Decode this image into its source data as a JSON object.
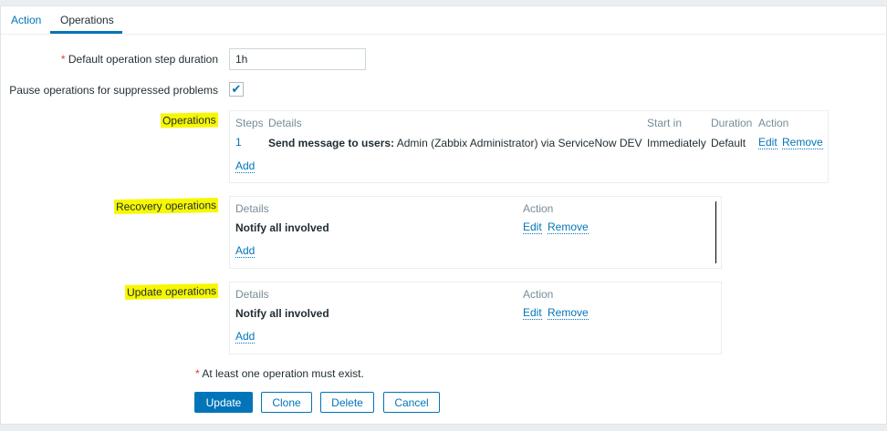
{
  "tabs": [
    {
      "label": "Action"
    },
    {
      "label": "Operations",
      "active": true
    }
  ],
  "form": {
    "step_duration_label": "Default operation step duration",
    "step_duration_value": "1h",
    "pause_label": "Pause operations for suppressed problems",
    "pause_checked": true,
    "required_mark": "*"
  },
  "operations": {
    "label": "Operations",
    "headers": {
      "steps": "Steps",
      "details": "Details",
      "start_in": "Start in",
      "duration": "Duration",
      "action": "Action"
    },
    "rows": [
      {
        "step": "1",
        "details_bold": "Send message to users:",
        "details_rest": " Admin (Zabbix Administrator) via ServiceNow DEV",
        "start_in": "Immediately",
        "duration": "Default",
        "edit": "Edit",
        "remove": "Remove"
      }
    ],
    "add": "Add"
  },
  "recovery": {
    "label": "Recovery operations",
    "headers": {
      "details": "Details",
      "action": "Action"
    },
    "rows": [
      {
        "details": "Notify all involved",
        "edit": "Edit",
        "remove": "Remove"
      }
    ],
    "add": "Add"
  },
  "update": {
    "label": "Update operations",
    "headers": {
      "details": "Details",
      "action": "Action"
    },
    "rows": [
      {
        "details": "Notify all involved",
        "edit": "Edit",
        "remove": "Remove"
      }
    ],
    "add": "Add"
  },
  "note": "At least one operation must exist.",
  "buttons": {
    "update": "Update",
    "clone": "Clone",
    "delete": "Delete",
    "cancel": "Cancel"
  },
  "colors": {
    "accent": "#0275b8",
    "highlight": "#f7f700",
    "required": "#e33734"
  }
}
